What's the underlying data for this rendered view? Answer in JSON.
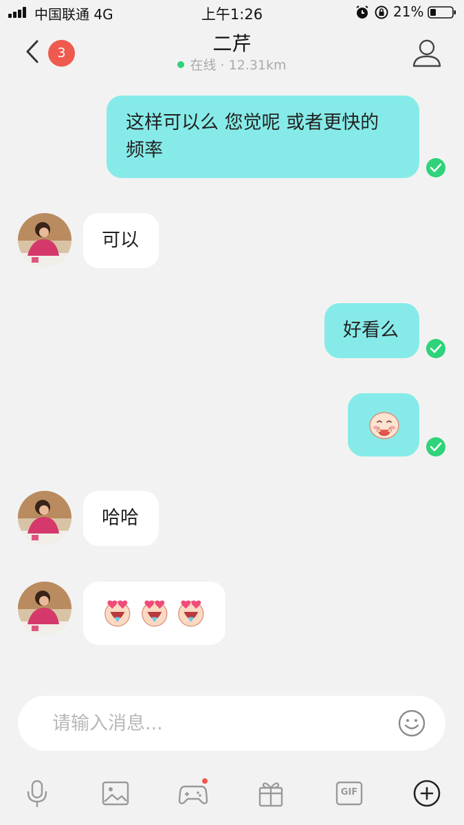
{
  "status_bar": {
    "carrier": "中国联通 4G",
    "time": "上午1:26",
    "battery": "21%"
  },
  "header": {
    "unread_count": "3",
    "contact_name": "二芹",
    "presence": "在线 · 12.31km"
  },
  "messages": [
    {
      "direction": "outgoing",
      "lines": [
        "这样可以么 您觉呢 或者更快的",
        "频率"
      ],
      "status": "read"
    },
    {
      "direction": "incoming",
      "text": "可以"
    },
    {
      "direction": "outgoing",
      "text": "好看么",
      "status": "read"
    },
    {
      "direction": "outgoing",
      "sticker": "blushing-face-emoji",
      "status": "read"
    },
    {
      "direction": "incoming",
      "text": "哈哈"
    },
    {
      "direction": "incoming",
      "stickers": [
        "heart-eyes-emoji",
        "heart-eyes-emoji",
        "heart-eyes-emoji"
      ]
    }
  ],
  "input": {
    "placeholder": "请输入消息..."
  },
  "toolbar": {
    "items": [
      "microphone-icon",
      "image-icon",
      "game-controller-icon",
      "gift-icon",
      "gif-icon",
      "plus-circle-icon"
    ],
    "gif_label": "GIF"
  },
  "colors": {
    "outgoing_bubble": "#86ebe8",
    "incoming_bubble": "#ffffff",
    "read_check": "#2ed37a",
    "badge": "#ef5a4f",
    "background": "#f2f2f2"
  }
}
